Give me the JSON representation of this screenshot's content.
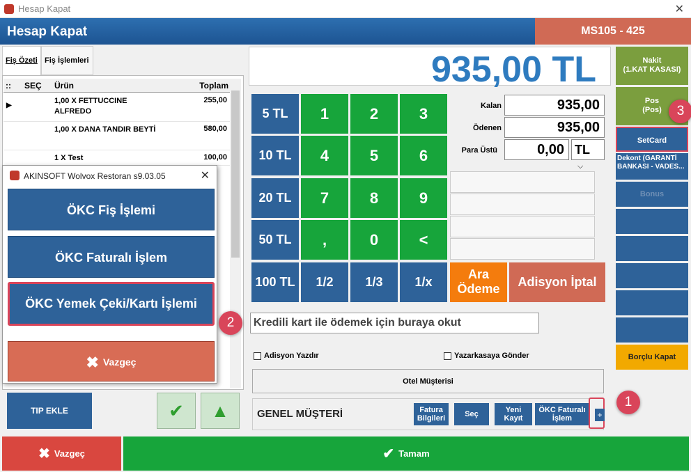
{
  "window": {
    "title": "Hesap Kapat",
    "close_glyph": "✕"
  },
  "header": {
    "title": "Hesap Kapat",
    "table_id": "MS105 - 425"
  },
  "tabs": [
    {
      "label": "Fiş Özeti"
    },
    {
      "label": "Fiş İşlemleri"
    }
  ],
  "grid": {
    "columns": {
      "sel": "::",
      "sec": "SEÇ",
      "urun": "Ürün",
      "toplam": "Toplam"
    },
    "rows": [
      {
        "product": "1,00 X FETTUCCINE ALFREDO",
        "total": "255,00"
      },
      {
        "product": "1,00 X DANA TANDIR BEYTİ",
        "total": "580,00"
      },
      {
        "product": "1 X Test",
        "total": "100,00"
      }
    ]
  },
  "dialog": {
    "title": "AKINSOFT Wolvox Restoran s9.03.05",
    "close_glyph": "✕",
    "btn1": "ÖKC Fiş İşlemi",
    "btn2": "ÖKC Faturalı İşlem",
    "btn3": "ÖKC Yemek Çeki/Kartı İşlemi",
    "cancel": "Vazgeç"
  },
  "badges": {
    "b1": "1",
    "b2": "2",
    "b3": "3"
  },
  "left_bottom": {
    "tip": "TIP EKLE"
  },
  "total": {
    "amount": "935,00 TL"
  },
  "keypad": {
    "money": [
      "5 TL",
      "10 TL",
      "20 TL",
      "50 TL",
      "100 TL"
    ],
    "digits": [
      "1",
      "2",
      "3",
      "4",
      "5",
      "6",
      "7",
      "8",
      "9",
      ",",
      "0",
      "<"
    ],
    "fractions": [
      "1/2",
      "1/3",
      "1/x"
    ]
  },
  "summary": {
    "kalan_label": "Kalan",
    "kalan_value": "935,00",
    "odenen_label": "Ödenen",
    "odenen_value": "935,00",
    "paraustu_label": "Para Üstü",
    "paraustu_value": "0,00",
    "currency": "TL"
  },
  "actions": {
    "ara_odeme_1": "Ara",
    "ara_odeme_2": "Ödeme",
    "adisyon_iptal": "Adisyon İptal"
  },
  "barcode": {
    "text": "Kredili kart ile ödemek için buraya okut"
  },
  "checks": {
    "adisyon": "Adisyon Yazdır",
    "yazarkasa": "Yazarkasaya Gönder"
  },
  "otel": "Otel Müşterisi",
  "customer": {
    "name": "GENEL MÜŞTERİ",
    "fatura_1": "Fatura",
    "fatura_2": "Bilgileri",
    "sec": "Seç",
    "yeni_1": "Yeni",
    "yeni_2": "Kayıt",
    "okc_1": "ÖKC Faturalı",
    "okc_2": "İşlem",
    "plus": "+"
  },
  "right": {
    "nakit_1": "Nakit",
    "nakit_2": "(1.KAT KASASI)",
    "pos_1": "Pos",
    "pos_2": "(Pos)",
    "setcard": "SetCard",
    "dekont_1": "Dekont (GARANTİ",
    "dekont_2": "BANKASI - VADES...",
    "bonus": "Bonus",
    "borclu": "Borçlu Kapat"
  },
  "bottom": {
    "cancel": "Vazgeç",
    "ok": "Tamam"
  },
  "colors": {
    "accent": "#2e6299",
    "green": "#17a53b",
    "orange": "#f47c0d",
    "red": "#d06a55",
    "highlight": "#d9455a"
  }
}
